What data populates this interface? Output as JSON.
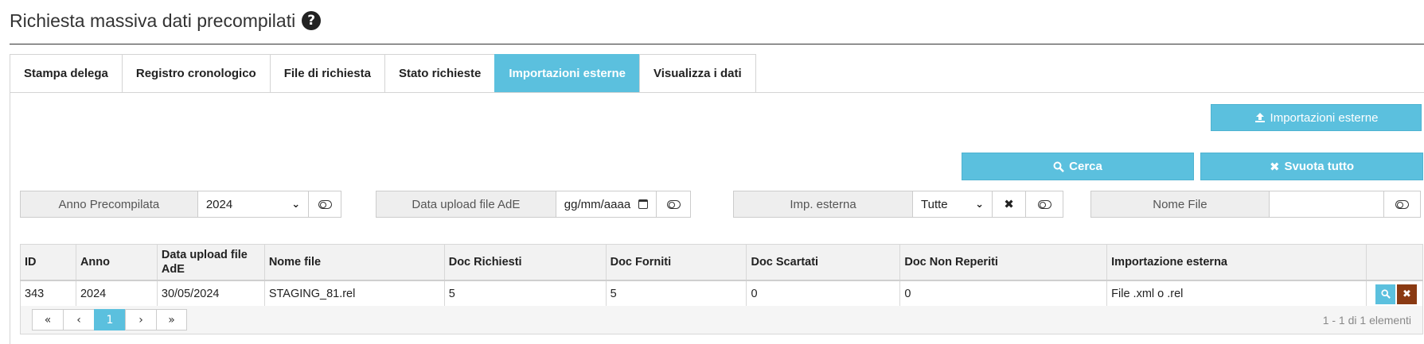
{
  "page": {
    "title": "Richiesta massiva dati precompilati",
    "help_glyph": "?"
  },
  "tabs": [
    {
      "label": "Stampa delega",
      "active": false
    },
    {
      "label": "Registro cronologico",
      "active": false
    },
    {
      "label": "File di richiesta",
      "active": false
    },
    {
      "label": "Stato richieste",
      "active": false
    },
    {
      "label": "Importazioni esterne",
      "active": true
    },
    {
      "label": "Visualizza i dati",
      "active": false
    }
  ],
  "actions": {
    "import_label": "Importazioni esterne",
    "search_label": "Cerca",
    "clear_label": "Svuota tutto"
  },
  "filters": {
    "anno": {
      "label": "Anno Precompilata",
      "value": "2024"
    },
    "data_upload": {
      "label": "Data upload file AdE",
      "placeholder": "gg/mm/aaaa"
    },
    "imp_esterna": {
      "label": "Imp. esterna",
      "value": "Tutte"
    },
    "nome_file": {
      "label": "Nome File",
      "value": ""
    }
  },
  "table": {
    "columns": [
      "ID",
      "Anno",
      "Data upload file AdE",
      "Nome file",
      "Doc Richiesti",
      "Doc Forniti",
      "Doc Scartati",
      "Doc Non Reperiti",
      "Importazione esterna"
    ],
    "rows": [
      {
        "id": "343",
        "anno": "2024",
        "data_upload": "30/05/2024",
        "nome_file": "STAGING_81.rel",
        "doc_richiesti": "5",
        "doc_forniti": "5",
        "doc_scartati": "0",
        "doc_non_reperiti": "0",
        "importazione_esterna": "File .xml o .rel"
      }
    ]
  },
  "pagination": {
    "first": "«",
    "prev": "‹",
    "current": "1",
    "next": "›",
    "last": "»",
    "info": "1 - 1 di 1 elementi"
  },
  "colors": {
    "accent": "#5bc0de",
    "danger": "#8a3a13"
  }
}
